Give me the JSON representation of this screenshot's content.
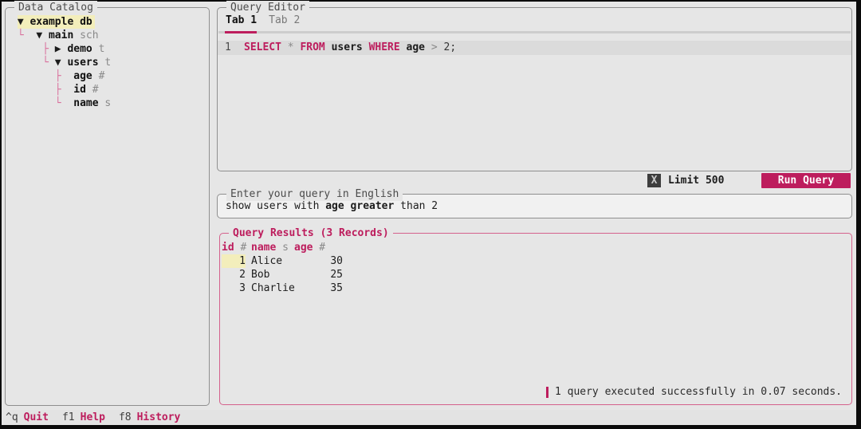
{
  "colors": {
    "accent": "#bd1d5d",
    "tree_line": "#d9709c",
    "selection_highlight": "#f3eebb",
    "results_border": "#d4618c",
    "background": "#e6e6e6"
  },
  "catalog": {
    "title": "Data Catalog",
    "items": [
      {
        "prefix": " ",
        "arrow": "▼ ",
        "name": "example",
        "type": " db"
      },
      {
        "prefix": " └  ",
        "arrow": "▼ ",
        "name": "main",
        "type": " sch"
      },
      {
        "prefix": "     ├ ",
        "arrow": "▶ ",
        "name": "demo",
        "type": " t"
      },
      {
        "prefix": "     └ ",
        "arrow": "▼ ",
        "name": "users",
        "type": " t"
      },
      {
        "prefix": "       ├  ",
        "arrow": "",
        "name": "age",
        "type": " #"
      },
      {
        "prefix": "       ├  ",
        "arrow": "",
        "name": "id",
        "type": " #"
      },
      {
        "prefix": "       └  ",
        "arrow": "",
        "name": "name",
        "type": " s"
      }
    ]
  },
  "editor": {
    "title": "Query Editor",
    "tabs": [
      {
        "label": "Tab 1"
      },
      {
        "label": "Tab 2"
      }
    ],
    "sql": {
      "line_no": "1",
      "kw1": "SELECT ",
      "op1": "* ",
      "kw2": "FROM ",
      "id1": "users ",
      "kw3": "WHERE ",
      "id2": "age ",
      "op2": "> ",
      "num": "2;"
    }
  },
  "run_bar": {
    "checkbox_glyph": "X",
    "limit_label": "Limit 500",
    "run_label": "Run Query"
  },
  "nl": {
    "title": "Enter your query in English",
    "seg1": "show users with ",
    "seg2": "age ",
    "seg3": "greater ",
    "seg4": "than 2"
  },
  "results": {
    "title": "Query Results (3 Records)",
    "columns": [
      {
        "name": "id",
        "type": " #"
      },
      {
        "name": "name",
        "type": " s"
      },
      {
        "name": "age",
        "type": " #"
      }
    ],
    "rows": [
      {
        "id": "1",
        "name": "Alice",
        "age": "30"
      },
      {
        "id": "2",
        "name": "Bob",
        "age": "25"
      },
      {
        "id": "3",
        "name": "Charlie",
        "age": "35"
      }
    ],
    "status_message": "1 query executed successfully in 0.07 seconds."
  },
  "footer": {
    "items": [
      {
        "key": "^q",
        "label": "Quit"
      },
      {
        "key": "f1",
        "label": "Help"
      },
      {
        "key": "f8",
        "label": "History"
      }
    ]
  }
}
